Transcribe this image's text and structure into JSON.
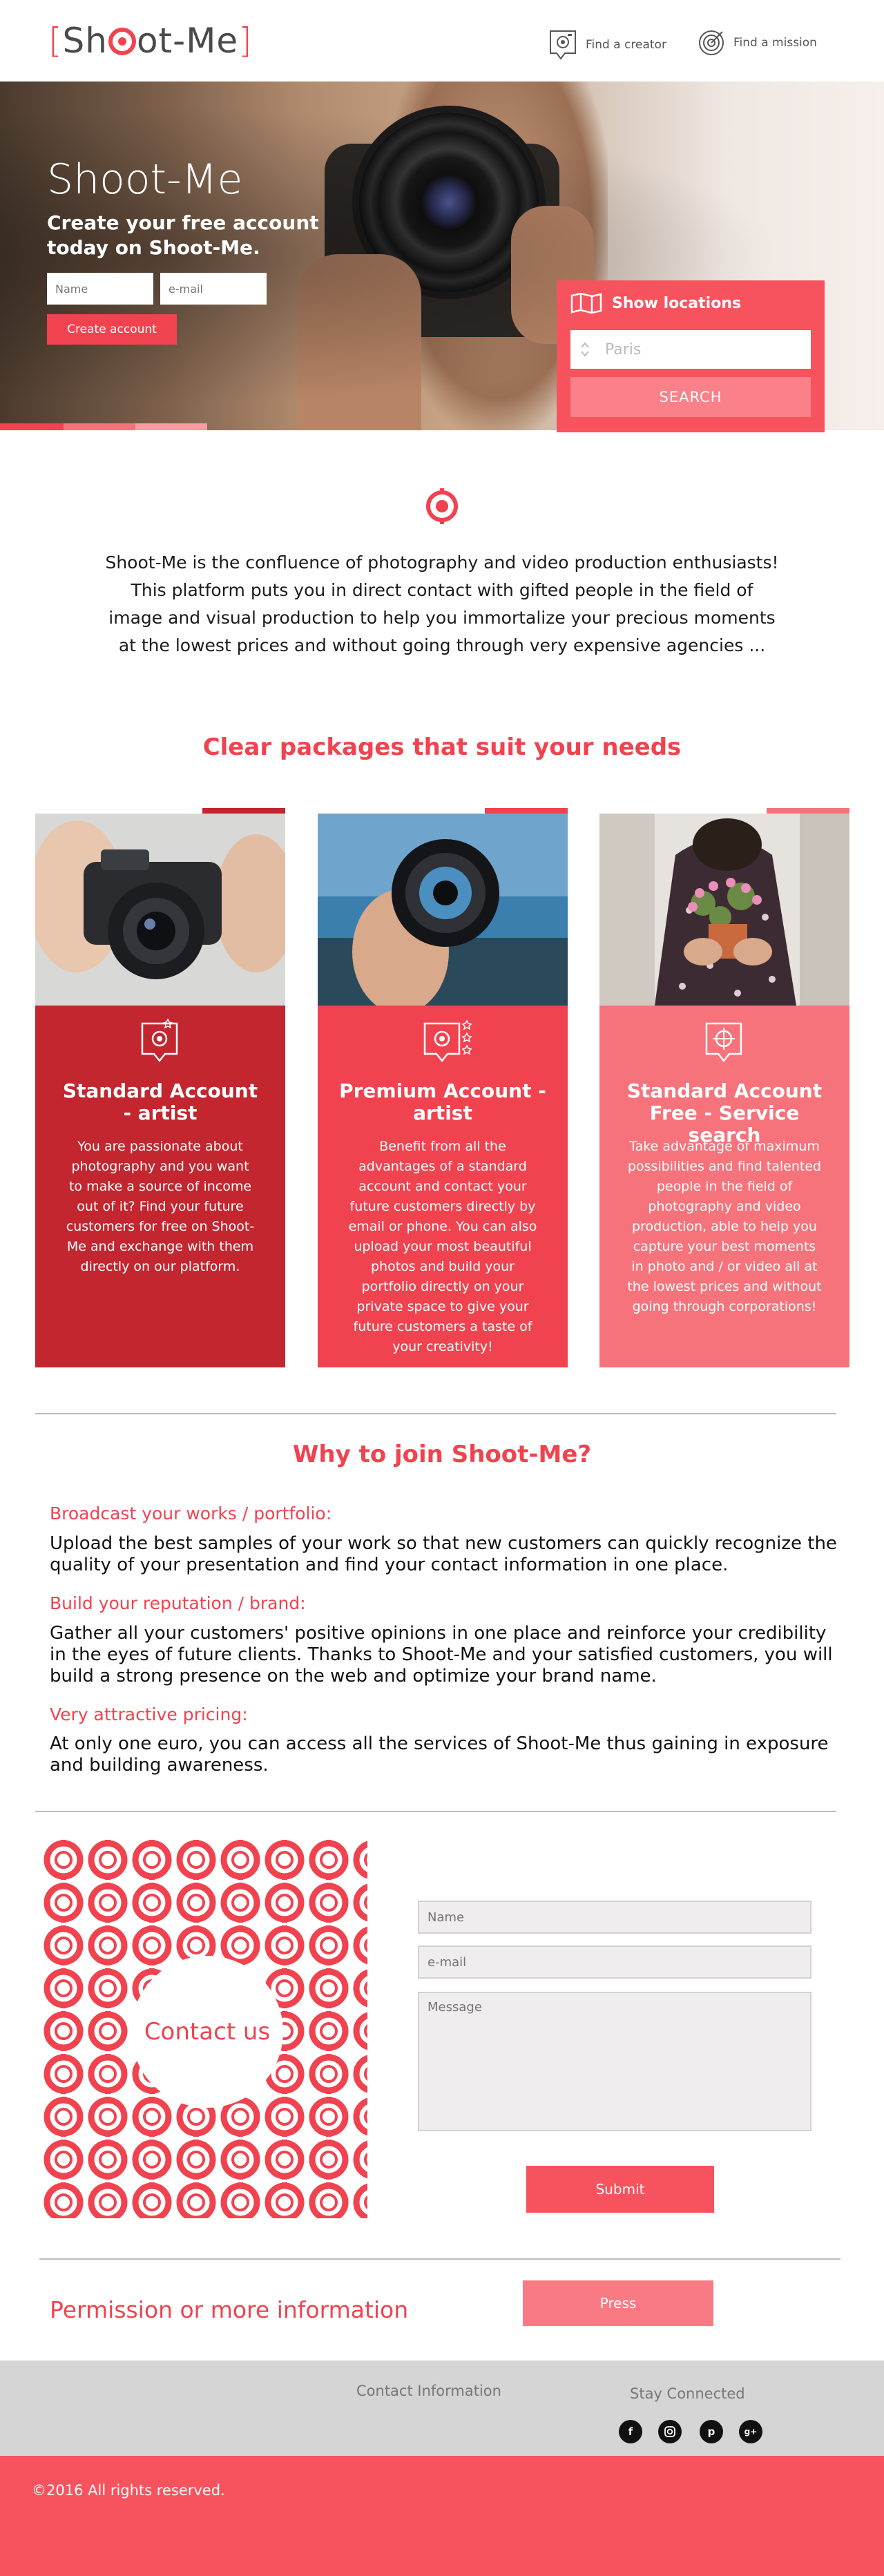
{
  "brand": {
    "logo_left": "[Sh",
    "logo_right": "ot-Me]"
  },
  "nav": [
    {
      "label": "Find a creator",
      "icon": "creator-camera-icon"
    },
    {
      "label": "Find a mission",
      "icon": "target-icon"
    }
  ],
  "hero": {
    "title": "Shoot-Me",
    "subtitle": "Create your free account today on Shoot-Me.",
    "name_placeholder": "Name",
    "email_placeholder": "e-mail",
    "create_button": "Create account"
  },
  "locations": {
    "heading": "Show locations",
    "select_value": "Paris",
    "search_button": "SEARCH"
  },
  "intro": {
    "text": "Shoot-Me is the confluence of photography and video production enthusiasts! This platform puts you in direct contact with gifted people in the field of image and visual production to help you immortalize your precious moments at the lowest prices and without going through very expensive agencies ..."
  },
  "packages": {
    "title": "Clear packages that suit your needs",
    "cards": [
      {
        "title": "Standard Account - artist",
        "text": "You are passionate about photography and you want to make a source of income out of it? Find your future customers for free on Shoot-Me and exchange with them directly on our platform.",
        "color": "#c3262f"
      },
      {
        "title": "Premium Account - artist",
        "text": "Benefit from all the advantages of a standard account and contact your future customers directly by email or phone. You can also upload your most beautiful photos and build your portfolio directly on your private space to give your future customers a taste of your creativity!",
        "color": "#f0434f"
      },
      {
        "title": "Standard Account Free - Service search",
        "text": "Take advantage of maximum possibilities and find talented people in the field of photography and video production, able to help you capture your best moments in photo and / or video all at the lowest prices and without going through corporations!",
        "color": "#f6737b"
      }
    ]
  },
  "why": {
    "title": "Why to join Shoot-Me?",
    "items": [
      {
        "heading": "Broadcast your works / portfolio:",
        "text": "Upload the best samples of your work so that new customers can quickly recognize the quality of your presentation and find your contact information in one place."
      },
      {
        "heading": "Build your reputation / brand:",
        "text": "Gather all your customers' positive opinions in one place and reinforce your credibility in the eyes of future clients. Thanks to Shoot-Me and your satisfied customers, you will build a strong presence on the web and optimize your brand name."
      },
      {
        "heading": "Very attractive pricing:",
        "text": "At only one euro, you can access all the services of Shoot-Me thus gaining in exposure and building awareness."
      }
    ]
  },
  "contact": {
    "circle_label": "Contact us",
    "name_placeholder": "Name",
    "email_placeholder": "e-mail",
    "message_placeholder": "Message",
    "submit": "Submit"
  },
  "permission": {
    "text": "Permission or more information",
    "button": "Press"
  },
  "footer": {
    "contact_info": "Contact Information",
    "stay_connected": "Stay Connected",
    "social": [
      "facebook-icon",
      "instagram-icon",
      "pinterest-icon",
      "google-plus-icon"
    ],
    "copyright": "©2016 All rights reserved."
  },
  "colors": {
    "accent": "#f0434f",
    "dark_red": "#c3262f",
    "light_red": "#f6737b",
    "footer_gray": "#d5d5d5"
  }
}
